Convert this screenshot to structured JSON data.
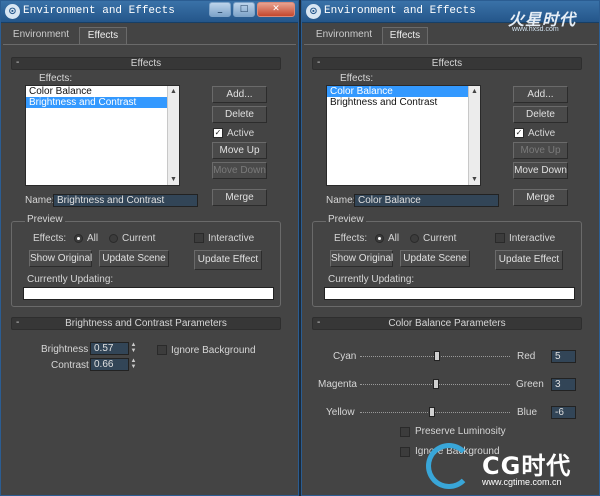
{
  "left_window": {
    "title": "Environment and Effects",
    "tabs": [
      "Environment",
      "Effects"
    ],
    "effects_rollout": "Effects",
    "effects_label": "Effects:",
    "effects_list": [
      "Color Balance",
      "Brightness and Contrast"
    ],
    "selected_index": 1,
    "buttons": {
      "add": "Add...",
      "delete": "Delete",
      "active": "Active",
      "move_up": "Move Up",
      "move_down": "Move Down",
      "merge": "Merge"
    },
    "active_checked": true,
    "move_up_enabled": true,
    "move_down_enabled": false,
    "name_label": "Name:",
    "name_value": "Brightness and Contrast",
    "preview": {
      "label": "Preview",
      "effects_label": "Effects:",
      "all": "All",
      "current": "Current",
      "interactive": "Interactive",
      "show_original": "Show Original",
      "update_scene": "Update Scene",
      "update_effect": "Update Effect",
      "currently_updating": "Currently Updating:"
    },
    "params_rollout": "Brightness and Contrast Parameters",
    "brightness_label": "Brightness",
    "brightness_value": "0.57",
    "contrast_label": "Contrast",
    "contrast_value": "0.66",
    "ignore_background": "Ignore Background"
  },
  "right_window": {
    "title": "Environment and Effects",
    "tabs": [
      "Environment",
      "Effects"
    ],
    "effects_rollout": "Effects",
    "effects_label": "Effects:",
    "effects_list": [
      "Color Balance",
      "Brightness and Contrast"
    ],
    "selected_index": 0,
    "buttons": {
      "add": "Add...",
      "delete": "Delete",
      "active": "Active",
      "move_up": "Move Up",
      "move_down": "Move Down",
      "merge": "Merge"
    },
    "active_checked": true,
    "move_up_enabled": false,
    "move_down_enabled": true,
    "name_label": "Name:",
    "name_value": "Color Balance",
    "preview": {
      "label": "Preview",
      "effects_label": "Effects:",
      "all": "All",
      "current": "Current",
      "interactive": "Interactive",
      "show_original": "Show Original",
      "update_scene": "Update Scene",
      "update_effect": "Update Effect",
      "currently_updating": "Currently Updating:"
    },
    "params_rollout": "Color Balance Parameters",
    "sliders": [
      {
        "left": "Cyan",
        "right": "Red",
        "value": "5"
      },
      {
        "left": "Magenta",
        "right": "Green",
        "value": "3"
      },
      {
        "left": "Yellow",
        "right": "Blue",
        "value": "-6"
      }
    ],
    "preserve_luminosity": "Preserve  Luminosity",
    "ignore_background": "Ignore Background"
  },
  "watermarks": {
    "top_logo": "火星时代",
    "top_url": "www.hxsd.com",
    "bottom_logo": "CG时代",
    "bottom_url": "www.cgtime.com.cn"
  },
  "icons": {
    "app": "3dsmax-icon",
    "minimize": "minimize-icon",
    "maximize": "maximize-icon",
    "close": "close-icon"
  }
}
